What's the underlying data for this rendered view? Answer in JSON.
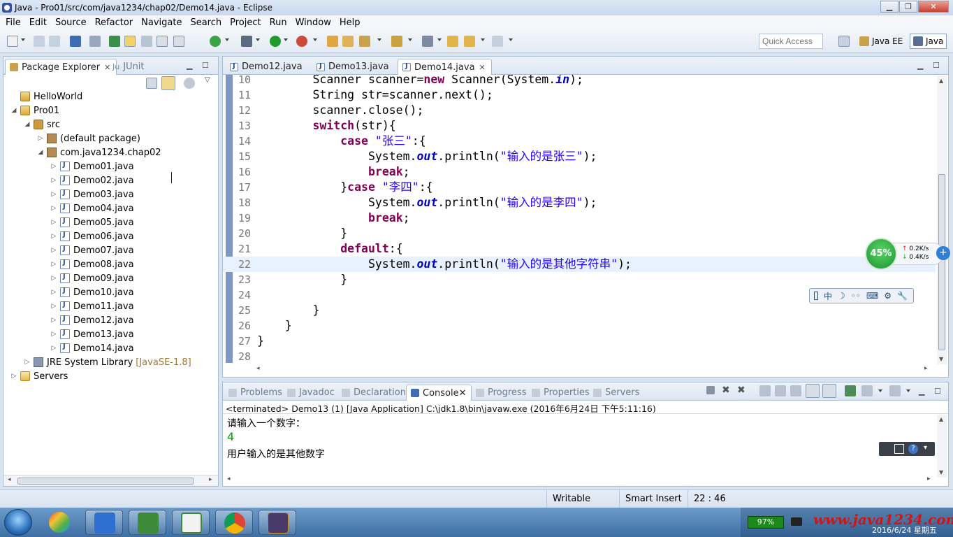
{
  "window": {
    "title": "Java - Pro01/src/com/java1234/chap02/Demo14.java - Eclipse",
    "buttons": [
      "▁",
      "❐",
      "✕"
    ]
  },
  "menu": [
    "File",
    "Edit",
    "Source",
    "Refactor",
    "Navigate",
    "Search",
    "Project",
    "Run",
    "Window",
    "Help"
  ],
  "toolbar": {
    "quick_access": "Quick Access",
    "perspectives": [
      "Java EE",
      "Java"
    ]
  },
  "package_explorer": {
    "tabs": [
      "Package Explorer",
      "JUnit"
    ],
    "tab_icon_prefix": [
      "⊞",
      "Ju"
    ],
    "tree": [
      {
        "label": "HelloWorld",
        "icon": "project-icon",
        "twisty": ""
      },
      {
        "label": "Pro01",
        "icon": "project-icon",
        "twisty": "◢"
      },
      {
        "label": "src",
        "icon": "source-folder-icon",
        "twisty": "◢"
      },
      {
        "label": "(default package)",
        "icon": "package-icon",
        "twisty": "▷"
      },
      {
        "label": "com.java1234.chap02",
        "icon": "package-icon",
        "twisty": "◢"
      },
      {
        "label": "Demo01.java",
        "icon": "java-file-icon",
        "twisty": "▷"
      },
      {
        "label": "Demo02.java",
        "icon": "java-file-icon",
        "twisty": "▷"
      },
      {
        "label": "Demo03.java",
        "icon": "java-file-icon",
        "twisty": "▷"
      },
      {
        "label": "Demo04.java",
        "icon": "java-file-icon",
        "twisty": "▷"
      },
      {
        "label": "Demo05.java",
        "icon": "java-file-icon",
        "twisty": "▷"
      },
      {
        "label": "Demo06.java",
        "icon": "java-file-icon",
        "twisty": "▷"
      },
      {
        "label": "Demo07.java",
        "icon": "java-file-icon",
        "twisty": "▷"
      },
      {
        "label": "Demo08.java",
        "icon": "java-file-icon",
        "twisty": "▷"
      },
      {
        "label": "Demo09.java",
        "icon": "java-file-icon",
        "twisty": "▷"
      },
      {
        "label": "Demo10.java",
        "icon": "java-file-icon",
        "twisty": "▷"
      },
      {
        "label": "Demo11.java",
        "icon": "java-file-icon",
        "twisty": "▷"
      },
      {
        "label": "Demo12.java",
        "icon": "java-file-icon",
        "twisty": "▷"
      },
      {
        "label": "Demo13.java",
        "icon": "java-file-icon",
        "twisty": "▷"
      },
      {
        "label": "Demo14.java",
        "icon": "java-file-icon",
        "twisty": "▷"
      },
      {
        "label": "JRE System Library",
        "icon": "library-icon",
        "twisty": "▷",
        "note": "[JavaSE-1.8]"
      },
      {
        "label": "Servers",
        "icon": "folder-icon",
        "twisty": "▷"
      }
    ]
  },
  "editor": {
    "tabs": [
      "Demo12.java",
      "Demo13.java",
      "Demo14.java"
    ],
    "active_tab": "Demo14.java",
    "current_line": "22",
    "lines": [
      {
        "n": "10",
        "code": "        Scanner scanner=new Scanner(System.in);"
      },
      {
        "n": "11",
        "code": "        String str=scanner.next();"
      },
      {
        "n": "12",
        "code": "        scanner.close();"
      },
      {
        "n": "13",
        "code": "        switch(str){"
      },
      {
        "n": "14",
        "code": "            case \"张三\":{"
      },
      {
        "n": "15",
        "code": "                System.out.println(\"输入的是张三\");"
      },
      {
        "n": "16",
        "code": "                break;"
      },
      {
        "n": "17",
        "code": "            }case \"李四\":{"
      },
      {
        "n": "18",
        "code": "                System.out.println(\"输入的是李四\");"
      },
      {
        "n": "19",
        "code": "                break;"
      },
      {
        "n": "20",
        "code": "            }"
      },
      {
        "n": "21",
        "code": "            default:{"
      },
      {
        "n": "22",
        "code": "                System.out.println(\"输入的是其他字符串\");"
      },
      {
        "n": "23",
        "code": "            }"
      },
      {
        "n": "24",
        "code": ""
      },
      {
        "n": "25",
        "code": "        }"
      },
      {
        "n": "26",
        "code": "    }"
      },
      {
        "n": "27",
        "code": "}"
      },
      {
        "n": "28",
        "code": ""
      }
    ]
  },
  "console": {
    "tabs": [
      "Problems",
      "Javadoc",
      "Declaration",
      "Console",
      "Progress",
      "Properties",
      "Servers"
    ],
    "active_tab": "Console",
    "description": "<terminated> Demo13 (1) [Java Application] C:\\jdk1.8\\bin\\javaw.exe (2016年6月24日 下午5:11:16)",
    "output": [
      "请输入一个数字：",
      "4",
      "用户输入的是其他数字"
    ]
  },
  "status": {
    "writable": "Writable",
    "insert_mode": "Smart Insert",
    "position": "22 : 46"
  },
  "taskbar": {
    "battery": "97%",
    "watermark": "www.java1234.com",
    "date": "2016/6/24 星期五"
  },
  "widgets": {
    "net_percent": "45%",
    "upload": "0.2K/s",
    "download": "0.4K/s",
    "ime": [
      "中",
      "☽",
      "◦◦",
      "⌨",
      "⚙",
      "🔧"
    ]
  },
  "colors": {
    "keyword": "#7f0055",
    "field": "#0000c0",
    "string": "#2a00ff",
    "current_line": "#e8f2fe"
  }
}
